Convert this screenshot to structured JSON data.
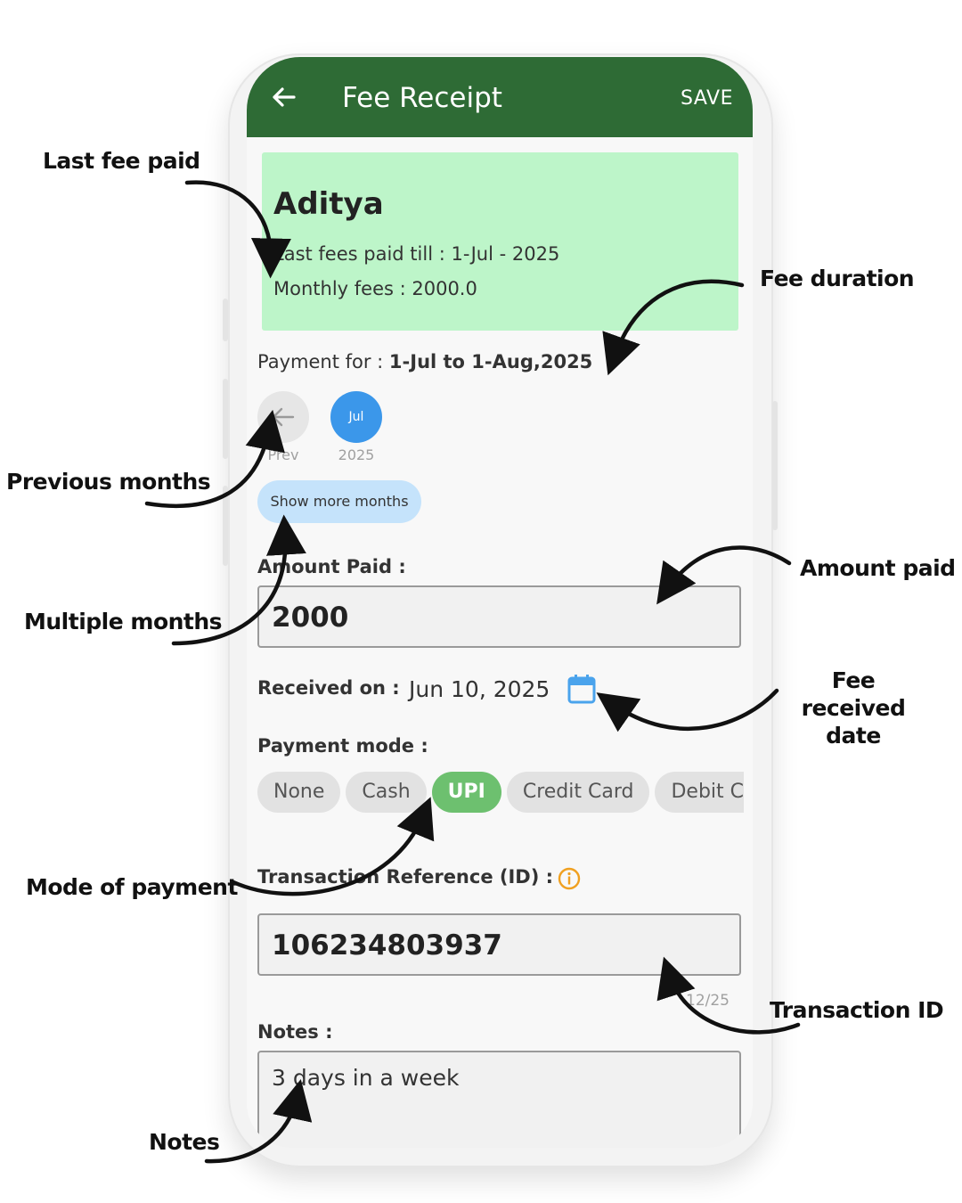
{
  "app_bar": {
    "title": "Fee Receipt",
    "save_label": "SAVE"
  },
  "student": {
    "name": "Aditya",
    "last_paid_label": "Last fees paid till : ",
    "last_paid_value": "1-Jul - 2025",
    "monthly_fees_label": "Monthly fees : ",
    "monthly_fees_value": "2000.0"
  },
  "payment_for": {
    "label": "Payment for : ",
    "value": "1-Jul to 1-Aug,2025"
  },
  "months": {
    "prev_label": "Prev",
    "selected_month": "Jul",
    "selected_year": "2025",
    "show_more_label": "Show more months"
  },
  "amount": {
    "label": "Amount Paid :",
    "value": "2000"
  },
  "received": {
    "label": "Received on :",
    "value": "Jun 10, 2025"
  },
  "payment_mode": {
    "label": "Payment mode :",
    "options": [
      "None",
      "Cash",
      "UPI",
      "Credit Card",
      "Debit Ca"
    ],
    "selected": "UPI"
  },
  "transaction": {
    "label": "Transaction Reference (ID) :",
    "value": "106234803937",
    "counter": "12/25"
  },
  "notes": {
    "label": "Notes :",
    "value": "3 days in a week"
  },
  "annotations": {
    "last_fee_paid": "Last fee paid",
    "fee_duration": "Fee duration",
    "previous_months": "Previous months",
    "amount_paid": "Amount paid",
    "multiple_months": "Multiple months",
    "fee_received_date_line1": "Fee received",
    "fee_received_date_line2": "date",
    "mode_of_payment": "Mode of payment",
    "transaction_id": "Transaction ID",
    "notes": "Notes"
  },
  "colors": {
    "app_bar": "#2e6b35",
    "card": "#bdf5c9",
    "selected_month": "#3b97ea",
    "selected_chip": "#6dc06f",
    "show_more": "#c5e3fb",
    "info_icon": "#f0a020",
    "calendar_icon": "#4aa3ec"
  },
  "icons": {
    "back": "arrow-left-icon",
    "prev": "arrow-left-icon",
    "calendar": "calendar-icon",
    "info": "info-icon"
  }
}
